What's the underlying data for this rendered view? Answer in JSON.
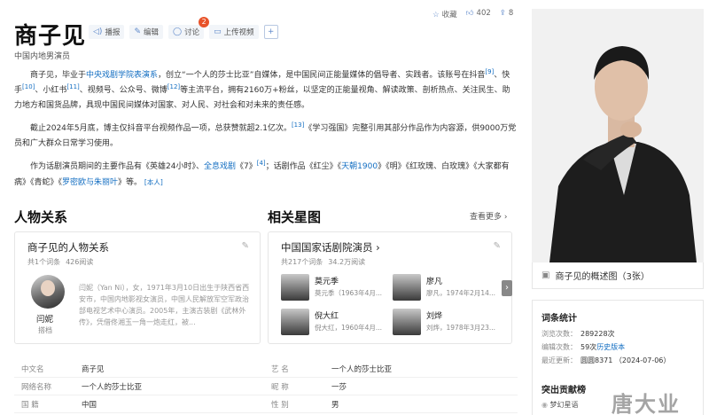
{
  "header": {
    "title": "商子见",
    "subtitle": "中国内地男演员",
    "actions": [
      {
        "icon": "speaker-icon",
        "label": "播报"
      },
      {
        "icon": "pencil-icon",
        "label": "编辑"
      },
      {
        "icon": "comment-icon",
        "label": "讨论",
        "badge": "2"
      },
      {
        "icon": "video-icon",
        "label": "上传视频"
      }
    ],
    "plus_icon": "+",
    "favorite": {
      "icon": "star-icon",
      "label": "收藏"
    },
    "likes": {
      "icon": "thumbs-up-icon",
      "count": "402"
    },
    "shares": {
      "icon": "share-icon",
      "count": "8"
    }
  },
  "intro": {
    "p1": {
      "a": "商子见，毕业于",
      "link1": "中央戏剧学院表演系",
      "b": "，创立“一个人的莎士比亚”自媒体，是中国民间正能量媒体的倡导者、实践者。该账号在抖音",
      "sup9": "[9]",
      "c": "、快手",
      "sup10": "[10]",
      "d": "、小红书",
      "sup11": "[11]",
      "e": "、视频号、公众号、微博",
      "sup12": "[12]",
      "f": "等主流平台，拥有2160万+粉丝，以坚定的正能量视角、解读政策、剖析热点、关注民生、助力地方和国货品牌，具现中国民间媒体对国家、对人民、对社会和对未来的责任感。"
    },
    "p2": {
      "a": "截止2024年5月底，博主仅抖音平台视频作品一项，总获赞就超2.1亿次。",
      "sup13": "[13]",
      "b": "《学习强国》完整引用其部分作品作为内容源，供9000万党员和广大群众日常学习使用。"
    },
    "p3": {
      "a": "作为话剧演员期间的主要作品有《英雄24小时》、",
      "link1": "全息戏剧",
      "b": "《7》",
      "sup4": "[4]",
      "c": "；话剧作品《红尘》《",
      "link2": "天朝1900",
      "d": "》《明》《红玫瑰、白玫瑰》《大家都有病》《青蛇》《",
      "link3": "罗密欧与朱丽叶",
      "e": "》等。",
      "tag": "[本人]"
    }
  },
  "relations": {
    "section_title": "人物关系",
    "card_title": "商子见的人物关系",
    "meta_count": "共1个词条",
    "meta_reads": "426阅读",
    "person": {
      "name": "闫妮",
      "relation": "搭档",
      "desc": "闫妮（Yan Ni），女，1971年3月10日出生于陕西省西安市，中国内地影视女演员，中国人民解放军空军政治部电视艺术中心演员。2005年，主演古装剧《武林外传》，凭借佟湘玉一角一炮走红，被..."
    }
  },
  "stars": {
    "section_title": "相关星图",
    "more_label": "查看更多",
    "card_title": "中国国家话剧院演员",
    "meta_count": "共217个词条",
    "meta_reads": "34.2万阅读",
    "items": [
      {
        "name": "莫元季",
        "desc": "莫元季（1963年4月..."
      },
      {
        "name": "廖凡",
        "desc": "廖凡，1974年2月14..."
      },
      {
        "name": "倪大红",
        "desc": "倪大红，1960年4月..."
      },
      {
        "name": "刘烨",
        "desc": "刘烨，1978年3月23..."
      }
    ]
  },
  "info_table": [
    {
      "k1": "中文名",
      "v1": "商子见",
      "k2": "艺  名",
      "v2": "一个人的莎士比亚"
    },
    {
      "k1": "网络名称",
      "v1": "一个人的莎士比亚",
      "k2": "昵  称",
      "v2": "一莎"
    },
    {
      "k1": "国  籍",
      "v1": "中国",
      "k2": "性  别",
      "v2": "男"
    }
  ],
  "sidebar": {
    "photo_caption": "商子见的概述图（3张）",
    "stats_title": "词条统计",
    "stats": [
      {
        "label": "浏览次数：",
        "value": "289228次"
      },
      {
        "label": "编辑次数：",
        "value": "59次",
        "link": "历史版本"
      },
      {
        "label": "最近更新：",
        "value": "圆圆8371  （2024-07-06）"
      }
    ],
    "contrib_title": "突出贡献榜",
    "contrib_user": "梦幻星语",
    "watermark": "唐大业"
  },
  "colors": {
    "link": "#136ec2",
    "accent": "#5b86c9",
    "badge": "#e8532a"
  }
}
